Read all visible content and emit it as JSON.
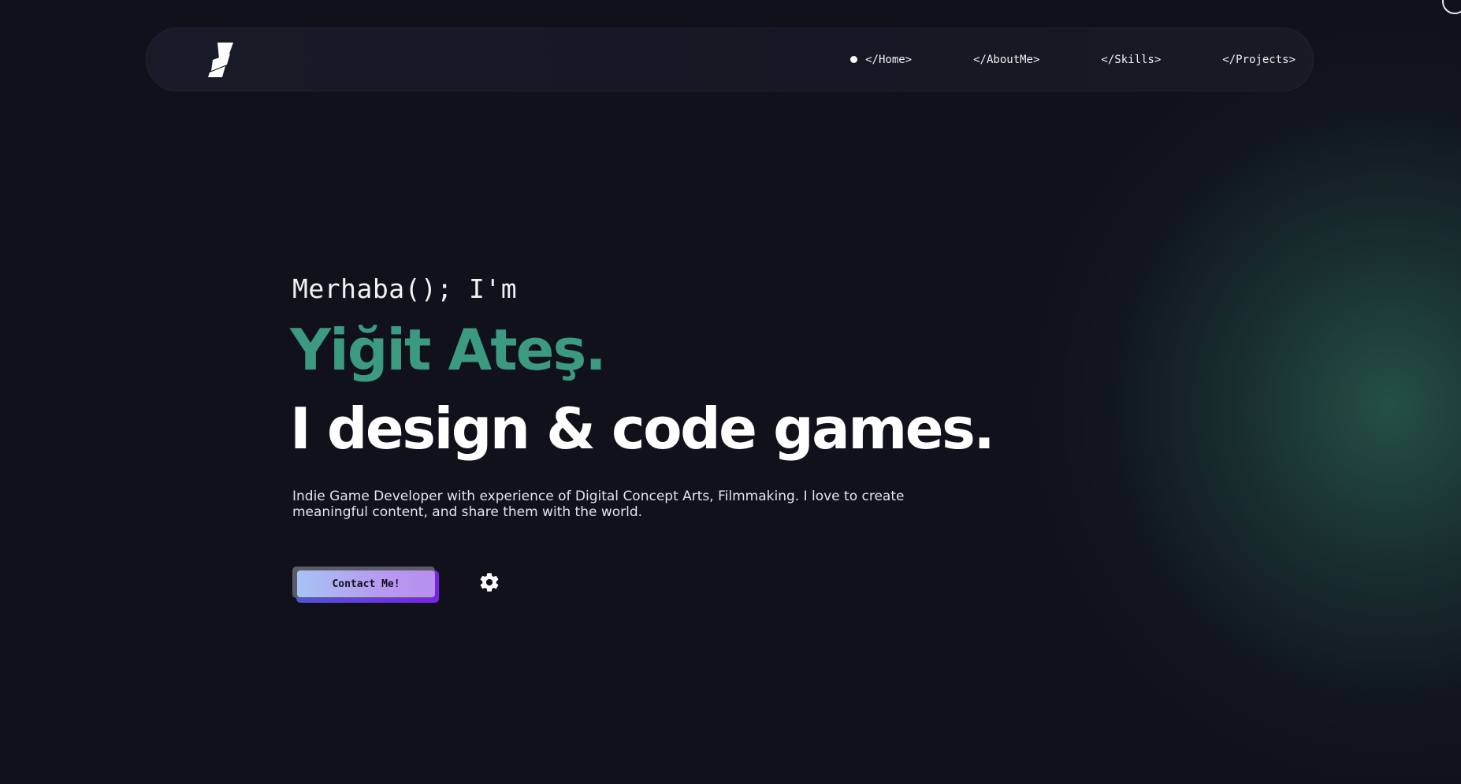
{
  "nav": {
    "logo_icon": "lightning-bolt-logo",
    "items": [
      {
        "label": "</Home>",
        "active": true
      },
      {
        "label": "</AboutMe>",
        "active": false
      },
      {
        "label": "</Skills>",
        "active": false
      },
      {
        "label": "</Projects>",
        "active": false
      }
    ]
  },
  "hero": {
    "greeting": "Merhaba(); I'm",
    "name": "Yiğit Ateş.",
    "tagline": "I design & code games.",
    "description": "Indie Game Developer with experience of Digital Concept Arts, Filmmaking. I love to create meaningful content, and share them with the world.",
    "contact_label": "Contact Me!",
    "settings_icon": "gear-icon"
  },
  "colors": {
    "background": "#10111b",
    "accent": "#3b9a80",
    "button_gradient_start": "#a7c3f4",
    "button_gradient_end": "#b78ff0",
    "button_shadow": "#7b22e8"
  }
}
